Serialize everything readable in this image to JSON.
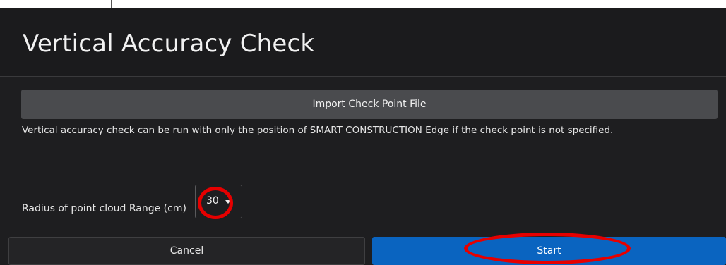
{
  "dialog": {
    "title": "Vertical Accuracy Check",
    "import_button_label": "Import Check Point File",
    "description": "Vertical accuracy check can be run with only the position of SMART CONSTRUCTION Edge if the check point is not specified.",
    "radius": {
      "label": "Radius of point cloud Range (cm)",
      "selected_value": "30"
    },
    "cancel_label": "Cancel",
    "start_label": "Start"
  },
  "colors": {
    "background": "#1e1e20",
    "import_button": "#4a4b4e",
    "start_button": "#0a64c0",
    "annotation": "#e60000"
  },
  "icons": {
    "dropdown": "chevron-down-icon"
  }
}
